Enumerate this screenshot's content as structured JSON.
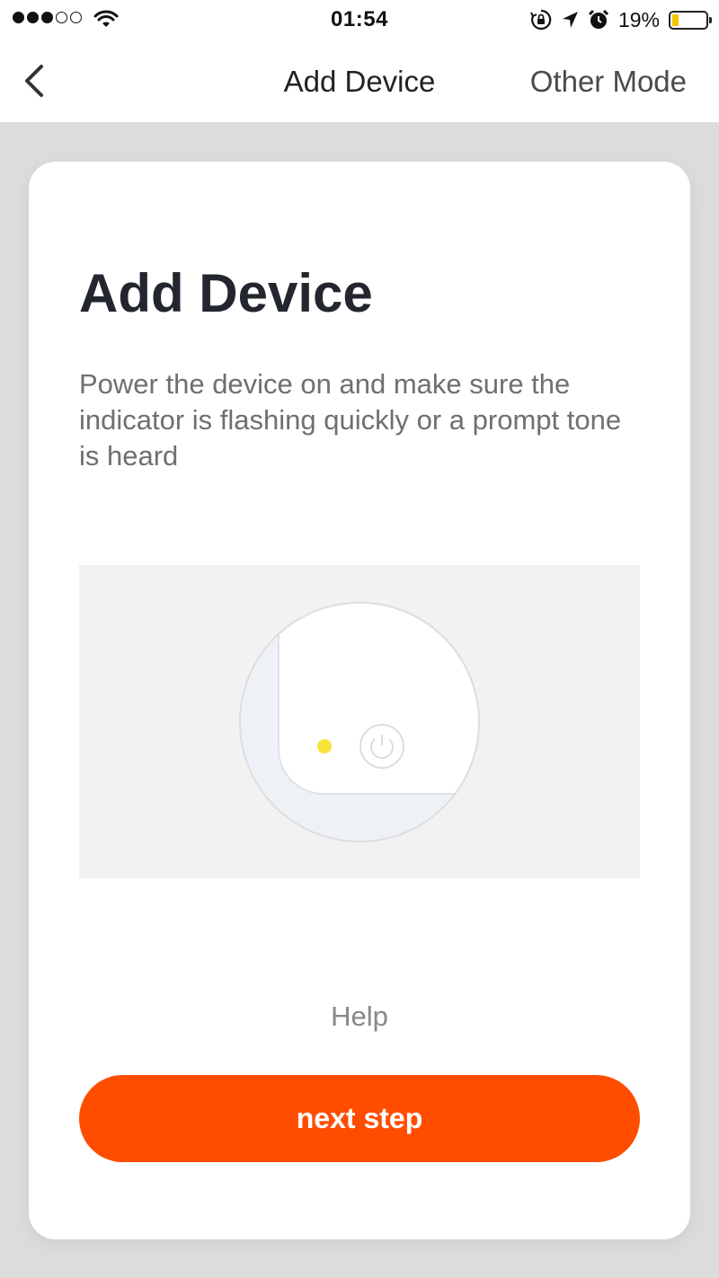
{
  "status_bar": {
    "time": "01:54",
    "battery_percent": "19%",
    "battery_level": 0.19,
    "signal_bars_filled": 3,
    "signal_bars_total": 5,
    "icons": [
      "signal-dots-icon",
      "wifi-icon",
      "orientation-lock-icon",
      "location-arrow-icon",
      "alarm-icon",
      "battery-icon"
    ]
  },
  "nav": {
    "back_icon": "chevron-left-icon",
    "title": "Add Device",
    "action": "Other Mode"
  },
  "card": {
    "title": "Add Device",
    "description": "Power the device on and make sure the indicator is flashing quickly or a prompt tone is heard",
    "illustration_icons": [
      "indicator-light-icon",
      "power-icon"
    ],
    "help_link": "Help",
    "next_button": "next step"
  },
  "colors": {
    "accent": "#ff4d00",
    "indicator_light": "#f8e33a",
    "battery_fill": "#f5c400",
    "background": "#dcdcdc"
  }
}
